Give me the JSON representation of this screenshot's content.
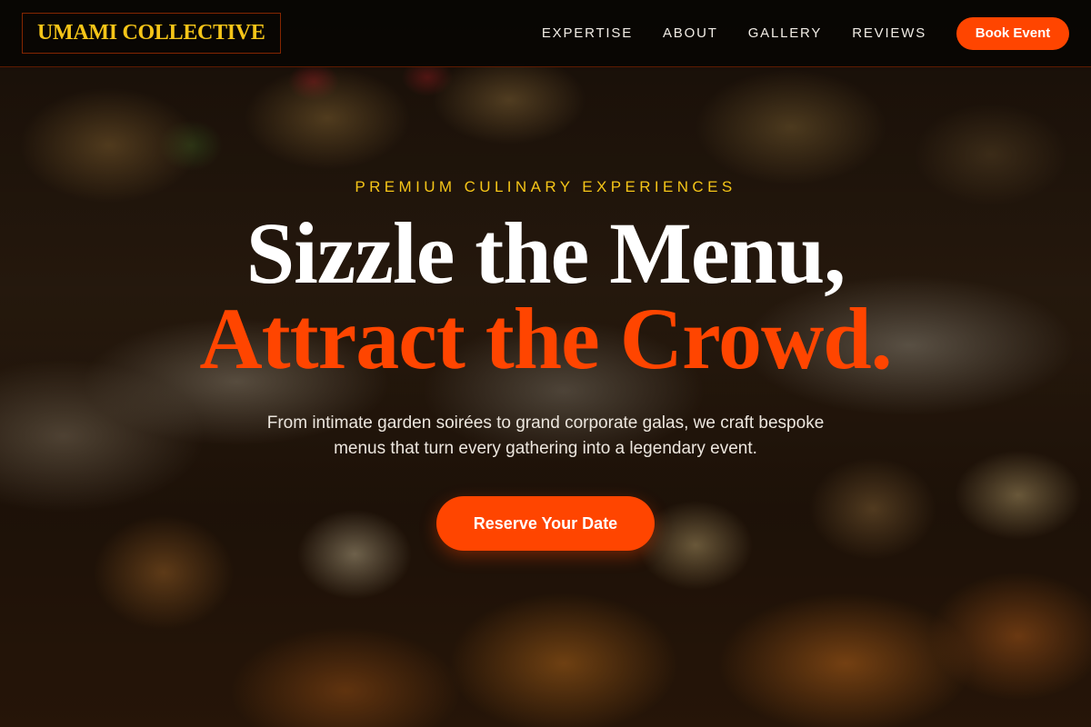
{
  "brand": {
    "name": "UMAMI COLLECTIVE"
  },
  "nav": {
    "links": [
      "EXPERTISE",
      "ABOUT",
      "GALLERY",
      "REVIEWS"
    ],
    "cta_label": "Book Event"
  },
  "hero": {
    "eyebrow": "PREMIUM CULINARY EXPERIENCES",
    "headline_line1": "Sizzle the Menu,",
    "headline_line2": "Attract the Crowd.",
    "subtitle": "From intimate garden soirées to grand corporate galas, we craft bespoke menus that turn every gathering into a legendary event.",
    "cta_label": "Reserve Your Date",
    "background_image": "food-platter-photo"
  },
  "colors": {
    "accent": "#ff4500",
    "gold": "#f5c518",
    "nav_bg": "#080503",
    "text_light": "#ffffff"
  }
}
